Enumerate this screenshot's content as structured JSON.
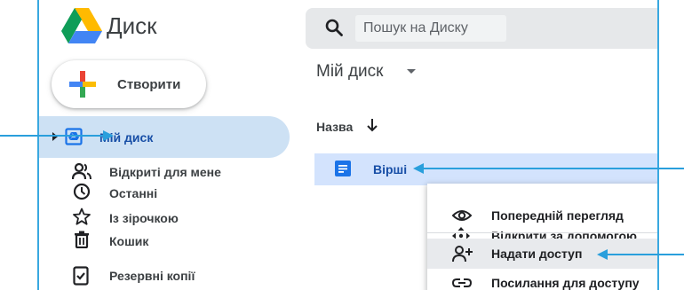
{
  "app": {
    "title": "Диск"
  },
  "search": {
    "placeholder": "Пошук на Диску"
  },
  "create": {
    "label": "Створити"
  },
  "sidebar": {
    "items": [
      {
        "label": "Мій диск",
        "icon": "my-drive-icon",
        "active": true
      },
      {
        "label": "Відкриті для мене",
        "icon": "shared-users-icon"
      },
      {
        "label": "Останні",
        "icon": "clock-icon"
      },
      {
        "label": "Із зірочкою",
        "icon": "star-icon"
      },
      {
        "label": "Кошик",
        "icon": "trash-icon"
      },
      {
        "label": "Резервні копії",
        "icon": "backup-device-icon"
      }
    ]
  },
  "main": {
    "title": "Мій диск",
    "column_name": "Назва",
    "file": {
      "name": "Вірші",
      "icon": "document-icon"
    }
  },
  "context_menu": {
    "items": [
      {
        "label": "Попередній перегляд",
        "icon": "eye-icon"
      },
      {
        "label": "Відкрити за допомогою",
        "icon": "move-arrows-icon"
      },
      {
        "label": "Надати доступ",
        "icon": "add-person-icon"
      },
      {
        "label": "Посилання для доступу",
        "icon": "link-icon"
      }
    ]
  },
  "colors": {
    "accent_blue": "#1a73e8",
    "active_nav_bg": "#cde1f4",
    "selected_row_bg": "#d3e3fd",
    "callout_blue": "#2a9fdc"
  }
}
